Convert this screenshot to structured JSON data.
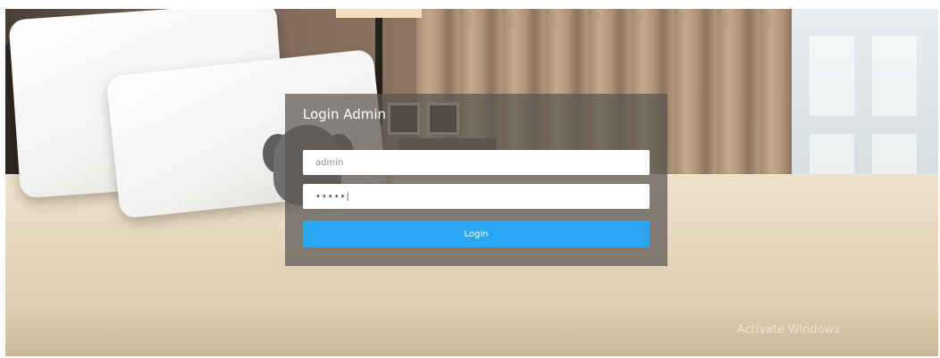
{
  "login": {
    "title": "Login Admin",
    "username_value": "admin",
    "password_value": "•••••|",
    "submit_label": "Login"
  },
  "overlay": {
    "watermark_text": "Activate Windows"
  },
  "colors": {
    "button": "#29a7f5",
    "panel": "#5a5450",
    "field": "#ffffff"
  },
  "icons": {
    "background": "hotel-bedroom-photo"
  }
}
